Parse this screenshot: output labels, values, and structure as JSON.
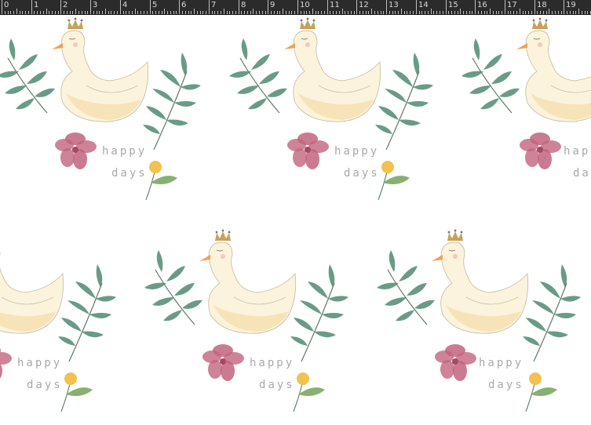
{
  "ruler": {
    "labels": [
      "0",
      "1",
      "2",
      "3",
      "4",
      "5",
      "6",
      "7",
      "8",
      "9",
      "10",
      "11",
      "12",
      "13",
      "14",
      "15",
      "16",
      "17",
      "18",
      "19"
    ]
  },
  "pattern": {
    "text_line1": "happy",
    "text_line2": "days",
    "colors": {
      "background": "#ffffff",
      "swan_body": "#fbf3dc",
      "swan_shade": "#f3dca8",
      "swan_outline": "#c9c0a8",
      "beak": "#f2a055",
      "crown": "#c8a15a",
      "leaf": "#4f8a72",
      "leaf_stem": "#5c7a66",
      "flower": "#c2647e",
      "yellow_bud": "#f2c14e",
      "bud_leaf": "#79a862",
      "text": "#a9a9a9",
      "ruler_bg": "#2b2b2b",
      "ruler_text": "#d8d8d8"
    }
  }
}
